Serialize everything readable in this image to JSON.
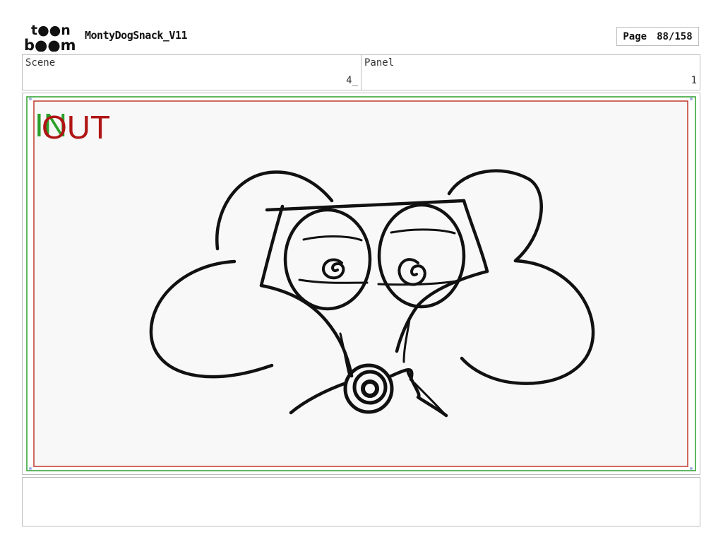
{
  "header": {
    "logo_top": "t●●n",
    "logo_bottom": "b●●m",
    "project_title": "MontyDogSnack_V11",
    "page_label": "Page",
    "page_number": "88/158"
  },
  "info": {
    "scene_label": "Scene",
    "scene_value": "4_",
    "panel_label": "Panel",
    "panel_value": "1"
  },
  "panel": {
    "in_label": "IN",
    "out_label": "OUT",
    "colors": {
      "in": "#2aa02a",
      "out": "#b01515",
      "sketch": "#111111"
    }
  },
  "notes": {
    "text": ""
  }
}
